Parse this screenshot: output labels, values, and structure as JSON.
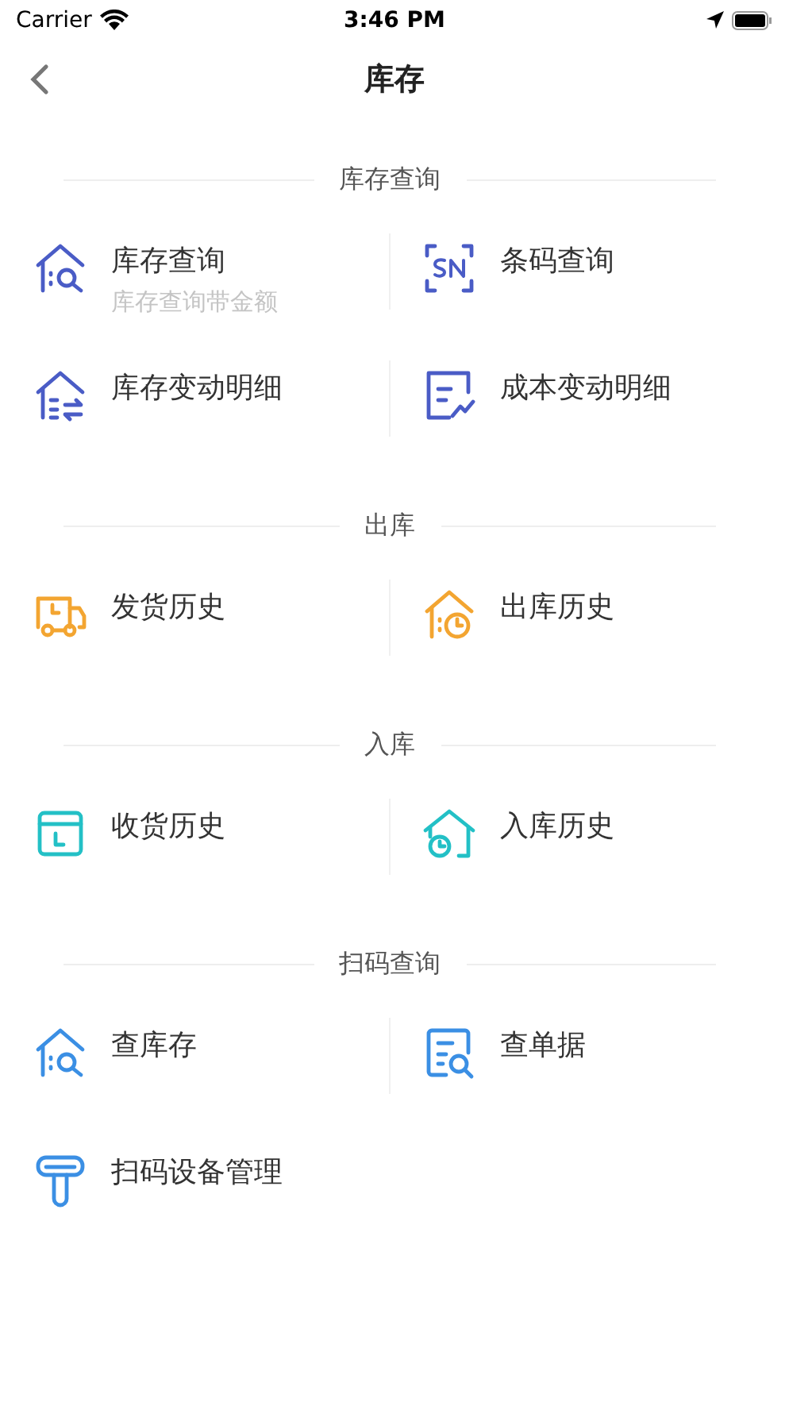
{
  "status_bar": {
    "carrier": "Carrier",
    "time": "3:46 PM"
  },
  "nav": {
    "title": "库存"
  },
  "sections": [
    {
      "title": "库存查询",
      "items": [
        {
          "label": "库存查询",
          "subtitle": "库存查询带金额",
          "kind": "house-search"
        },
        {
          "label": "条码查询",
          "kind": "sn"
        },
        {
          "label": "库存变动明细",
          "kind": "house-list"
        },
        {
          "label": "成本变动明细",
          "kind": "doc-chart"
        }
      ]
    },
    {
      "title": "出库",
      "items": [
        {
          "label": "发货历史",
          "kind": "truck"
        },
        {
          "label": "出库历史",
          "kind": "house-clock"
        }
      ]
    },
    {
      "title": "入库",
      "items": [
        {
          "label": "收货历史",
          "kind": "box-clock"
        },
        {
          "label": "入库历史",
          "kind": "home-clock"
        }
      ]
    },
    {
      "title": "扫码查询",
      "items": [
        {
          "label": "查库存",
          "kind": "house-search"
        },
        {
          "label": "查单据",
          "kind": "doc-search"
        },
        {
          "label": "扫码设备管理",
          "kind": "scanner"
        }
      ]
    }
  ]
}
